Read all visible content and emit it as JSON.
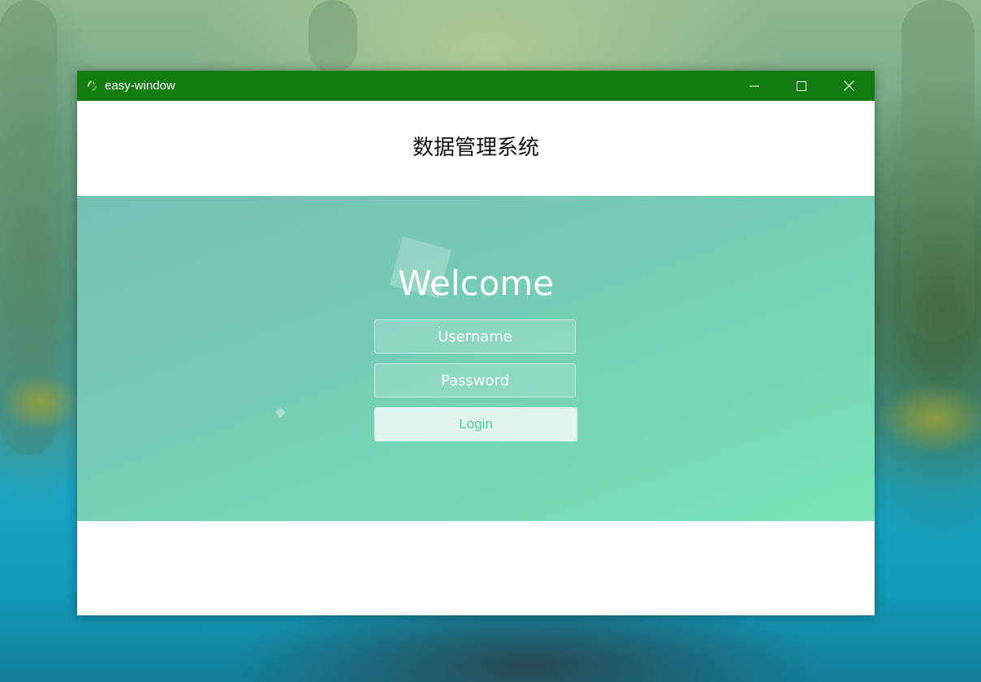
{
  "window": {
    "title": "easy-window",
    "title_bar_color": "#127c13",
    "app_icon": "recycle-icon",
    "controls": [
      "minimize-icon",
      "maximize-icon",
      "close-icon"
    ]
  },
  "header": {
    "system_title": "数据管理系统"
  },
  "login": {
    "welcome": "Welcome",
    "username_placeholder": "Username",
    "password_placeholder": "Password",
    "login_label": "Login",
    "band_gradient": [
      "#78bfb3",
      "#79e4b6"
    ],
    "button_text_color": "#4fcf97"
  }
}
